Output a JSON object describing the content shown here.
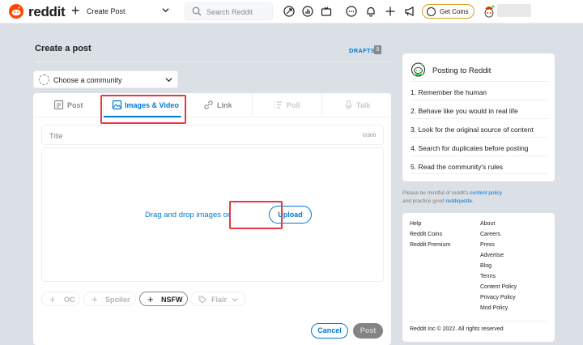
{
  "header": {
    "logo_text": "reddit",
    "create_post_label": "Create Post",
    "search_placeholder": "Search Reddit",
    "get_coins_label": "Get Coins"
  },
  "page": {
    "title": "Create a post",
    "drafts_label": "DRAFTS",
    "drafts_count": "0"
  },
  "community": {
    "placeholder": "Choose a community"
  },
  "tabs": [
    {
      "label": "Post",
      "icon": "post-icon",
      "active": false
    },
    {
      "label": "Images & Video",
      "icon": "image-icon",
      "active": true
    },
    {
      "label": "Link",
      "icon": "link-icon",
      "active": false
    },
    {
      "label": "Poll",
      "icon": "poll-icon",
      "active": false
    },
    {
      "label": "Talk",
      "icon": "mic-icon",
      "active": false
    }
  ],
  "editor": {
    "title_placeholder": "Title",
    "title_counter": "0/300",
    "drag_text": "Drag and drop images or",
    "upload_label": "Upload"
  },
  "flags": [
    {
      "label": "OC",
      "active": false
    },
    {
      "label": "Spoiler",
      "active": false
    },
    {
      "label": "NSFW",
      "active": true
    },
    {
      "label": "Flair",
      "active": false
    }
  ],
  "actions": {
    "cancel_label": "Cancel",
    "post_label": "Post"
  },
  "rules": {
    "title": "Posting to Reddit",
    "items": [
      "1. Remember the human",
      "2. Behave like you would in real life",
      "3. Look for the original source of content",
      "4. Search for duplicates before posting",
      "5. Read the community's rules"
    ]
  },
  "mindful": {
    "pre": "Please be mindful of reddit's",
    "policy_link": "content policy",
    "mid": "and practice good",
    "reddiquette_link": "reddiquette."
  },
  "footer": {
    "col1": [
      "Help",
      "Reddit Coins",
      "Reddit Premium"
    ],
    "col2": [
      "About",
      "Careers",
      "Press",
      "Advertise",
      "Blog",
      "Terms",
      "Content Policy",
      "Privacy Policy",
      "Mod Policy"
    ],
    "copyright": "Reddit Inc © 2022. All rights reserved"
  },
  "colors": {
    "accent": "#0079d3",
    "brand": "#ff4500",
    "highlight": "#e63946"
  }
}
